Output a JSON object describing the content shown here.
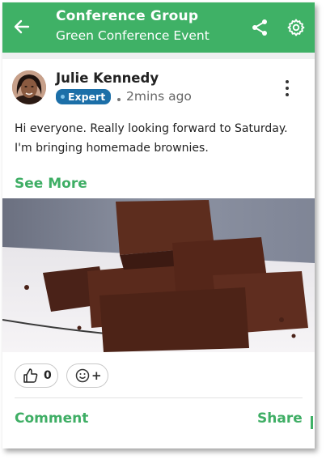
{
  "header": {
    "title": "Conference Group",
    "subtitle": "Green Conference Event",
    "back_icon": "arrow-left-icon",
    "share_icon": "share-icon",
    "settings_icon": "gear-icon",
    "color": "#3fb166"
  },
  "post": {
    "author": "Julie Kennedy",
    "badge": "Expert",
    "time": "2mins ago",
    "text": "Hi everyone. Really looking forward to Saturday. I'm bringing homemade brownies.",
    "see_more": "See More",
    "menu_icon": "more-vertical-icon"
  },
  "reactions": {
    "like_count": "0",
    "like_icon": "thumbs-up-icon",
    "emoji_icon": "smiley-icon",
    "emoji_add": "+"
  },
  "actions": {
    "comment": "Comment",
    "share": "Share"
  },
  "colors": {
    "accent": "#3fae65",
    "badge": "#1c6fa8"
  }
}
